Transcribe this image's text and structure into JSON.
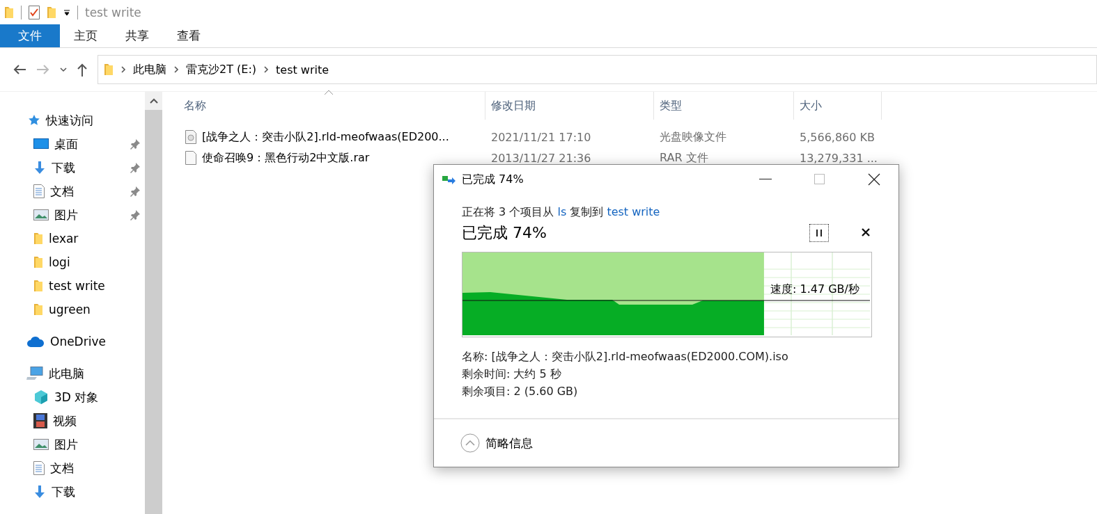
{
  "window": {
    "title": "test write"
  },
  "ribbon_tabs": [
    {
      "label": "文件",
      "selected": true
    },
    {
      "label": "主页",
      "selected": false
    },
    {
      "label": "共享",
      "selected": false
    },
    {
      "label": "查看",
      "selected": false
    }
  ],
  "address": {
    "crumbs": [
      "此电脑",
      "雷克沙2T (E:)",
      "test write"
    ]
  },
  "sidebar": {
    "sections": [
      {
        "label": "快速访问",
        "kind": "star",
        "items": [
          {
            "label": "桌面",
            "kind": "desktop",
            "pinned": true
          },
          {
            "label": "下载",
            "kind": "download",
            "pinned": true
          },
          {
            "label": "文档",
            "kind": "doc",
            "pinned": true
          },
          {
            "label": "图片",
            "kind": "picture",
            "pinned": true
          },
          {
            "label": "lexar",
            "kind": "folder",
            "pinned": false
          },
          {
            "label": "logi",
            "kind": "folder",
            "pinned": false
          },
          {
            "label": "test write",
            "kind": "folder",
            "pinned": false
          },
          {
            "label": "ugreen",
            "kind": "folder",
            "pinned": false
          }
        ]
      },
      {
        "label": "OneDrive",
        "kind": "cloud"
      },
      {
        "label": "此电脑",
        "kind": "pc",
        "items": [
          {
            "label": "3D 对象",
            "kind": "cube",
            "pinned": false
          },
          {
            "label": "视频",
            "kind": "video",
            "pinned": false
          },
          {
            "label": "图片",
            "kind": "picture",
            "pinned": false
          },
          {
            "label": "文档",
            "kind": "doc",
            "pinned": false
          },
          {
            "label": "下载",
            "kind": "download",
            "pinned": false
          }
        ]
      }
    ]
  },
  "table": {
    "columns": [
      "名称",
      "修改日期",
      "类型",
      "大小"
    ],
    "rows": [
      {
        "kind": "disc",
        "name": "[战争之人：突击小队2].rld-meofwaas(ED200...",
        "date": "2021/11/21 17:10",
        "type": "光盘映像文件",
        "size": "5,566,860 KB"
      },
      {
        "kind": "file",
        "name": "使命召唤9：黑色行动2中文版.rar",
        "date": "2013/11/27 21:36",
        "type": "RAR 文件",
        "size": "13,279,331 ..."
      }
    ]
  },
  "dialog": {
    "title": "已完成 74%",
    "line_parts": [
      "正在将 3 个项目从 ",
      "ls",
      " 复制到 ",
      "test write"
    ],
    "heading": "已完成 74%",
    "level": 0.74,
    "speed": "速度: 1.47 GB/秒",
    "details": [
      "名称: [战争之人：突击小队2].rld-meofwaas(ED2000.COM).iso",
      "剩余时间: 大约 5 秒",
      "剩余项目: 2 (5.60 GB)"
    ],
    "toggle": "简略信息"
  }
}
